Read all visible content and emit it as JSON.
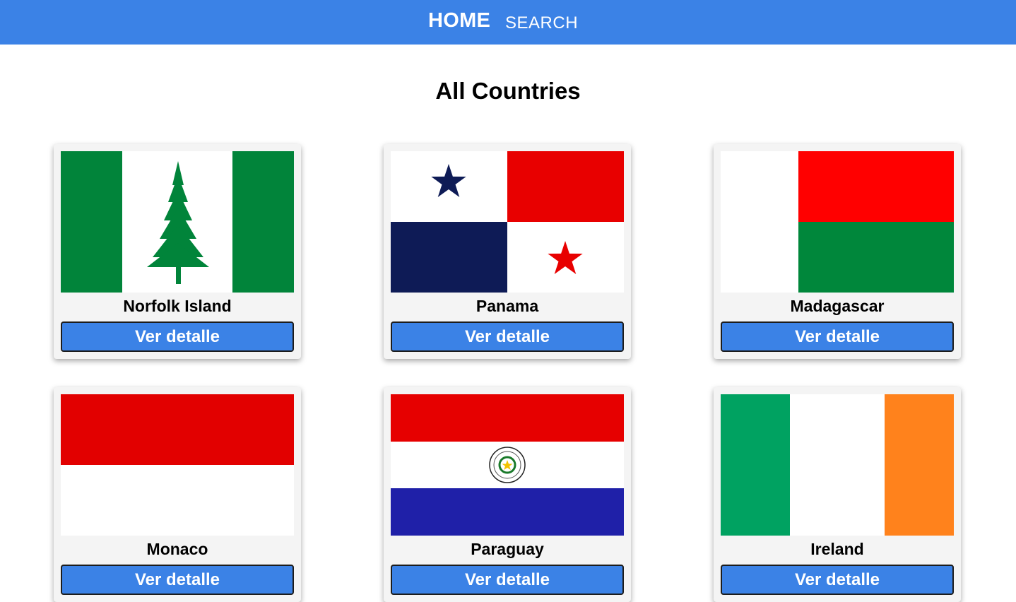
{
  "nav": {
    "home_label": "HOME",
    "search_label": "SEARCH"
  },
  "main": {
    "title": "All Countries",
    "countries": [
      {
        "name": "Norfolk Island",
        "button_label": "Ver detalle"
      },
      {
        "name": "Panama",
        "button_label": "Ver detalle"
      },
      {
        "name": "Madagascar",
        "button_label": "Ver detalle"
      },
      {
        "name": "Monaco",
        "button_label": "Ver detalle"
      },
      {
        "name": "Paraguay",
        "button_label": "Ver detalle"
      },
      {
        "name": "Ireland",
        "button_label": "Ver detalle"
      }
    ]
  },
  "colors": {
    "navbar": "#3b82e6",
    "button": "#3b82e6",
    "card_background": "#f4f4f4"
  }
}
